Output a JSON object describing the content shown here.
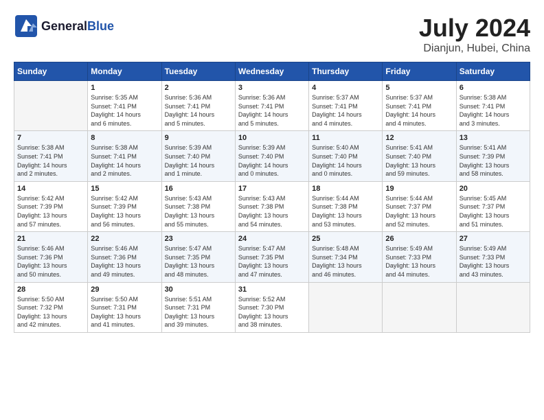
{
  "header": {
    "logo_general": "General",
    "logo_blue": "Blue",
    "month": "July 2024",
    "location": "Dianjun, Hubei, China"
  },
  "weekdays": [
    "Sunday",
    "Monday",
    "Tuesday",
    "Wednesday",
    "Thursday",
    "Friday",
    "Saturday"
  ],
  "weeks": [
    [
      {
        "day": "",
        "info": ""
      },
      {
        "day": "1",
        "info": "Sunrise: 5:35 AM\nSunset: 7:41 PM\nDaylight: 14 hours\nand 6 minutes."
      },
      {
        "day": "2",
        "info": "Sunrise: 5:36 AM\nSunset: 7:41 PM\nDaylight: 14 hours\nand 5 minutes."
      },
      {
        "day": "3",
        "info": "Sunrise: 5:36 AM\nSunset: 7:41 PM\nDaylight: 14 hours\nand 5 minutes."
      },
      {
        "day": "4",
        "info": "Sunrise: 5:37 AM\nSunset: 7:41 PM\nDaylight: 14 hours\nand 4 minutes."
      },
      {
        "day": "5",
        "info": "Sunrise: 5:37 AM\nSunset: 7:41 PM\nDaylight: 14 hours\nand 4 minutes."
      },
      {
        "day": "6",
        "info": "Sunrise: 5:38 AM\nSunset: 7:41 PM\nDaylight: 14 hours\nand 3 minutes."
      }
    ],
    [
      {
        "day": "7",
        "info": "Sunrise: 5:38 AM\nSunset: 7:41 PM\nDaylight: 14 hours\nand 2 minutes."
      },
      {
        "day": "8",
        "info": "Sunrise: 5:38 AM\nSunset: 7:41 PM\nDaylight: 14 hours\nand 2 minutes."
      },
      {
        "day": "9",
        "info": "Sunrise: 5:39 AM\nSunset: 7:40 PM\nDaylight: 14 hours\nand 1 minute."
      },
      {
        "day": "10",
        "info": "Sunrise: 5:39 AM\nSunset: 7:40 PM\nDaylight: 14 hours\nand 0 minutes."
      },
      {
        "day": "11",
        "info": "Sunrise: 5:40 AM\nSunset: 7:40 PM\nDaylight: 14 hours\nand 0 minutes."
      },
      {
        "day": "12",
        "info": "Sunrise: 5:41 AM\nSunset: 7:40 PM\nDaylight: 13 hours\nand 59 minutes."
      },
      {
        "day": "13",
        "info": "Sunrise: 5:41 AM\nSunset: 7:39 PM\nDaylight: 13 hours\nand 58 minutes."
      }
    ],
    [
      {
        "day": "14",
        "info": "Sunrise: 5:42 AM\nSunset: 7:39 PM\nDaylight: 13 hours\nand 57 minutes."
      },
      {
        "day": "15",
        "info": "Sunrise: 5:42 AM\nSunset: 7:39 PM\nDaylight: 13 hours\nand 56 minutes."
      },
      {
        "day": "16",
        "info": "Sunrise: 5:43 AM\nSunset: 7:38 PM\nDaylight: 13 hours\nand 55 minutes."
      },
      {
        "day": "17",
        "info": "Sunrise: 5:43 AM\nSunset: 7:38 PM\nDaylight: 13 hours\nand 54 minutes."
      },
      {
        "day": "18",
        "info": "Sunrise: 5:44 AM\nSunset: 7:38 PM\nDaylight: 13 hours\nand 53 minutes."
      },
      {
        "day": "19",
        "info": "Sunrise: 5:44 AM\nSunset: 7:37 PM\nDaylight: 13 hours\nand 52 minutes."
      },
      {
        "day": "20",
        "info": "Sunrise: 5:45 AM\nSunset: 7:37 PM\nDaylight: 13 hours\nand 51 minutes."
      }
    ],
    [
      {
        "day": "21",
        "info": "Sunrise: 5:46 AM\nSunset: 7:36 PM\nDaylight: 13 hours\nand 50 minutes."
      },
      {
        "day": "22",
        "info": "Sunrise: 5:46 AM\nSunset: 7:36 PM\nDaylight: 13 hours\nand 49 minutes."
      },
      {
        "day": "23",
        "info": "Sunrise: 5:47 AM\nSunset: 7:35 PM\nDaylight: 13 hours\nand 48 minutes."
      },
      {
        "day": "24",
        "info": "Sunrise: 5:47 AM\nSunset: 7:35 PM\nDaylight: 13 hours\nand 47 minutes."
      },
      {
        "day": "25",
        "info": "Sunrise: 5:48 AM\nSunset: 7:34 PM\nDaylight: 13 hours\nand 46 minutes."
      },
      {
        "day": "26",
        "info": "Sunrise: 5:49 AM\nSunset: 7:33 PM\nDaylight: 13 hours\nand 44 minutes."
      },
      {
        "day": "27",
        "info": "Sunrise: 5:49 AM\nSunset: 7:33 PM\nDaylight: 13 hours\nand 43 minutes."
      }
    ],
    [
      {
        "day": "28",
        "info": "Sunrise: 5:50 AM\nSunset: 7:32 PM\nDaylight: 13 hours\nand 42 minutes."
      },
      {
        "day": "29",
        "info": "Sunrise: 5:50 AM\nSunset: 7:31 PM\nDaylight: 13 hours\nand 41 minutes."
      },
      {
        "day": "30",
        "info": "Sunrise: 5:51 AM\nSunset: 7:31 PM\nDaylight: 13 hours\nand 39 minutes."
      },
      {
        "day": "31",
        "info": "Sunrise: 5:52 AM\nSunset: 7:30 PM\nDaylight: 13 hours\nand 38 minutes."
      },
      {
        "day": "",
        "info": ""
      },
      {
        "day": "",
        "info": ""
      },
      {
        "day": "",
        "info": ""
      }
    ]
  ]
}
